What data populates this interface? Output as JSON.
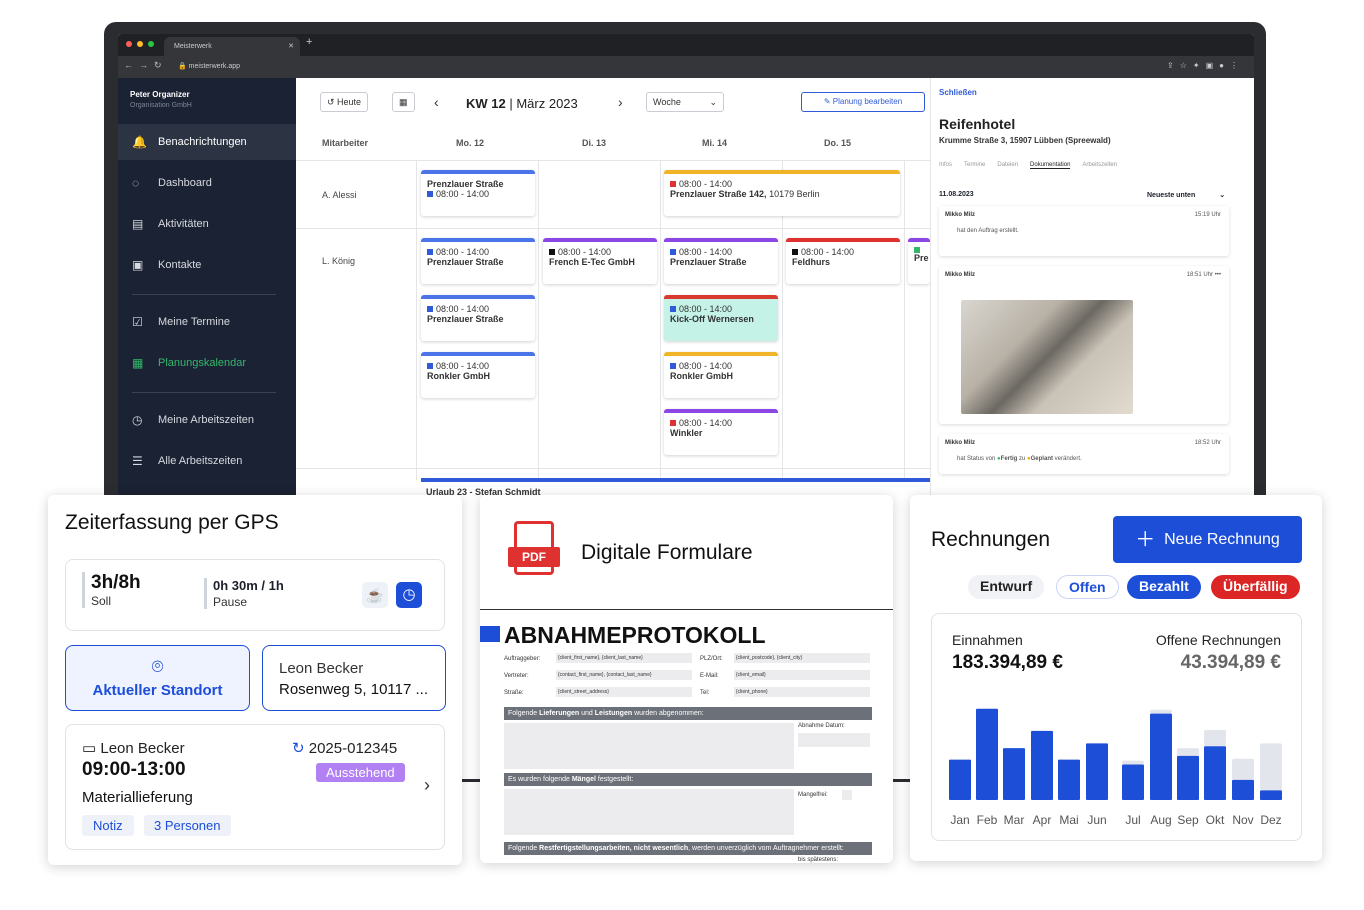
{
  "browser": {
    "tab_title": "Meisterwerk",
    "url": "meisterwerk.app"
  },
  "sidebar": {
    "org_name": "Peter Organizer",
    "org_sub": "Organisation GmbH",
    "items": [
      {
        "label": "Benachrichtungen",
        "icon": "bell-icon"
      },
      {
        "label": "Dashboard",
        "icon": "dashboard-icon"
      },
      {
        "label": "Aktivitäten",
        "icon": "document-icon"
      },
      {
        "label": "Kontakte",
        "icon": "contacts-icon"
      },
      {
        "label": "Meine Termine",
        "icon": "calendar-check-icon"
      },
      {
        "label": "Planungskalendar",
        "icon": "calendar-icon"
      },
      {
        "label": "Meine Arbeitszeiten",
        "icon": "clock-icon"
      },
      {
        "label": "Alle Arbeitszeiten",
        "icon": "list-icon"
      }
    ]
  },
  "calendar": {
    "today_label": "Heute",
    "week": "KW 12",
    "month": "März 2023",
    "view": "Woche",
    "edit_label": "Planung bearbeiten",
    "col_employee": "Mitarbeiter",
    "days": [
      "Mo. 12",
      "Di. 13",
      "Mi. 14",
      "Do. 15"
    ],
    "rows": [
      "A. Alessi",
      "L. König"
    ],
    "events": {
      "e1": {
        "line1": "Prenzlauer Straße",
        "line2": "08:00 - 14:00"
      },
      "e2": {
        "time": "08:00 - 14:00",
        "name": "Prenzlauer Straße 142,",
        "rest": " 10179 Berlin"
      },
      "e3": {
        "time": "08:00 - 14:00",
        "name": "Prenzlauer Straße"
      },
      "e4": {
        "time": "08:00 - 14:00",
        "name": "French E-Tec GmbH"
      },
      "e5": {
        "time": "08:00 - 14:00",
        "name": "Prenzlauer Straße"
      },
      "e6": {
        "time": "08:00 - 14:00",
        "name": "Feldhurs"
      },
      "e7": {
        "time": "08:00 - 14:00",
        "name": "Prenzlauer Straße"
      },
      "e8": {
        "time": "08:00 - 14:00",
        "name": "Kick-Off Wernersen"
      },
      "e9": {
        "time": "08:00 - 14:00",
        "name": "Ronkler GmbH"
      },
      "e10": {
        "time": "08:00 - 14:00",
        "name": "Ronkler GmbH"
      },
      "e11": {
        "time": "08:00 - 14:00",
        "name": "Winkler"
      },
      "e12": {
        "name": "Pre"
      }
    },
    "vacation": "Urlaub 23 - Stefan Schmidt"
  },
  "detail": {
    "close": "Schließen",
    "title": "Reifenhotel",
    "address": "Krumme Straße 3, 15907 Lübben (Spreewald)",
    "tabs": [
      "Infos",
      "Termine",
      "Dateien",
      "Dokumentation",
      "Arbeitszeiten"
    ],
    "date": "11.08.2023",
    "sort": "Neueste unten",
    "entries": [
      {
        "user": "Mikko Milz",
        "time": "15:19 Uhr",
        "text": "hat den Auftrag erstellt."
      },
      {
        "user": "Mikko Milz",
        "time": "18:51 Uhr"
      },
      {
        "user": "Mikko Milz",
        "time": "18:52 Uhr",
        "text": "hat Status von",
        "from": "Fertig",
        "to_word": "zu",
        "to": "Geplant",
        "end": "verändert."
      }
    ]
  },
  "gps": {
    "title": "Zeiterfassung per GPS",
    "hours": "3h/8h",
    "hours_label": "Soll",
    "pause": "0h 30m / 1h",
    "pause_label": "Pause",
    "location_label": "Aktueller Standort",
    "person": "Leon Becker",
    "address": "Rosenweg 5, 10117 ...",
    "job_person": "Leon Becker",
    "job_id": "2025-012345",
    "job_time": "09:00-13:00",
    "job_status": "Ausstehend",
    "job_title": "Materiallieferung",
    "tags": [
      "Notiz",
      "3 Personen"
    ]
  },
  "pdf": {
    "badge": "PDF",
    "title": "Digitale Formulare",
    "doc_title": "ABNAHMEPROTOKOLL",
    "fields_left": [
      {
        "label": "Auftraggeber:",
        "value": "{client_first_name}, {client_last_name}"
      },
      {
        "label": "Vertreter:",
        "value": "{contact_first_name}, {contact_last_name}"
      },
      {
        "label": "Straße:",
        "value": "{client_street_address}"
      }
    ],
    "fields_right": [
      {
        "label": "PLZ/Ort:",
        "value": "{client_postcode}, {client_city}"
      },
      {
        "label": "E-Mail:",
        "value": "{client_email}"
      },
      {
        "label": "Tel:",
        "value": "{client_phone}"
      }
    ],
    "bar1_a": "Folgende ",
    "bar1_b": "Lieferungen",
    "bar1_c": " und ",
    "bar1_d": "Leistungen",
    "bar1_e": " wurden abgenommen:",
    "accept_date": "Abnahme Datum:",
    "bar2_a": "Es wurden folgende ",
    "bar2_b": "Mängel",
    "bar2_c": " festgestellt:",
    "defect_free": "Mangelfrei:",
    "bar3_a": "Folgende ",
    "bar3_b": "Restfertigstellungsarbeiten, nicht wesentlich",
    "bar3_c": ", werden unverzüglich vom Auftragnehmer erstellt:",
    "deadline": "bis spätestens:"
  },
  "invoices": {
    "title": "Rechnungen",
    "new_button": "Neue Rechnung",
    "filters": [
      {
        "label": "Entwurf",
        "color": "#222222"
      },
      {
        "label": "Offen",
        "color": "#1d4ed8"
      },
      {
        "label": "Bezahlt",
        "color": "#1d4ed8"
      },
      {
        "label": "Überfällig",
        "color": "#dc2626"
      }
    ],
    "income_label": "Einnahmen",
    "income_value": "183.394,89 €",
    "open_label": "Offene Rechnungen",
    "open_value": "43.394,89 €"
  },
  "chart_data": {
    "type": "bar",
    "categories": [
      "Jan",
      "Feb",
      "Mar",
      "Apr",
      "Mai",
      "Jun",
      "Jul",
      "Aug",
      "Sep",
      "Okt",
      "Nov",
      "Dez"
    ],
    "series": [
      {
        "values": [
          42,
          95,
          54,
          72,
          42,
          59,
          37,
          90,
          46,
          56,
          21,
          10
        ]
      },
      {
        "values": [
          0,
          0,
          0,
          0,
          0,
          0,
          4,
          4,
          8,
          17,
          22,
          49
        ]
      }
    ],
    "colors": [
      "#1d4ed8",
      "#e2e5ec"
    ],
    "ylim": [
      0,
      100
    ],
    "grid": false
  }
}
